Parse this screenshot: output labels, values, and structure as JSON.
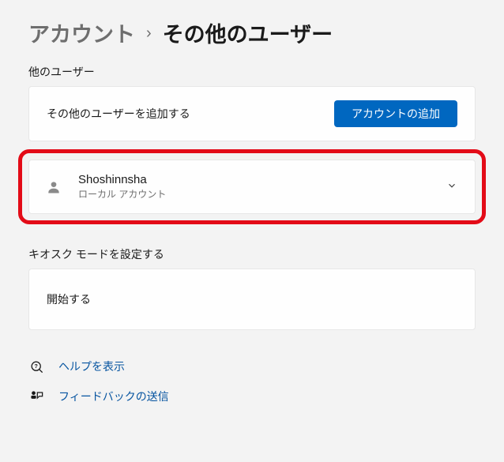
{
  "breadcrumb": {
    "parent": "アカウント",
    "current": "その他のユーザー"
  },
  "sections": {
    "other_users_label": "他のユーザー",
    "add_user_text": "その他のユーザーを追加する",
    "add_account_button": "アカウントの追加",
    "user": {
      "name": "Shoshinnsha",
      "type": "ローカル アカウント"
    },
    "kiosk_label": "キオスク モードを設定する",
    "kiosk_start": "開始する"
  },
  "links": {
    "help": "ヘルプを表示",
    "feedback": "フィードバックの送信"
  }
}
